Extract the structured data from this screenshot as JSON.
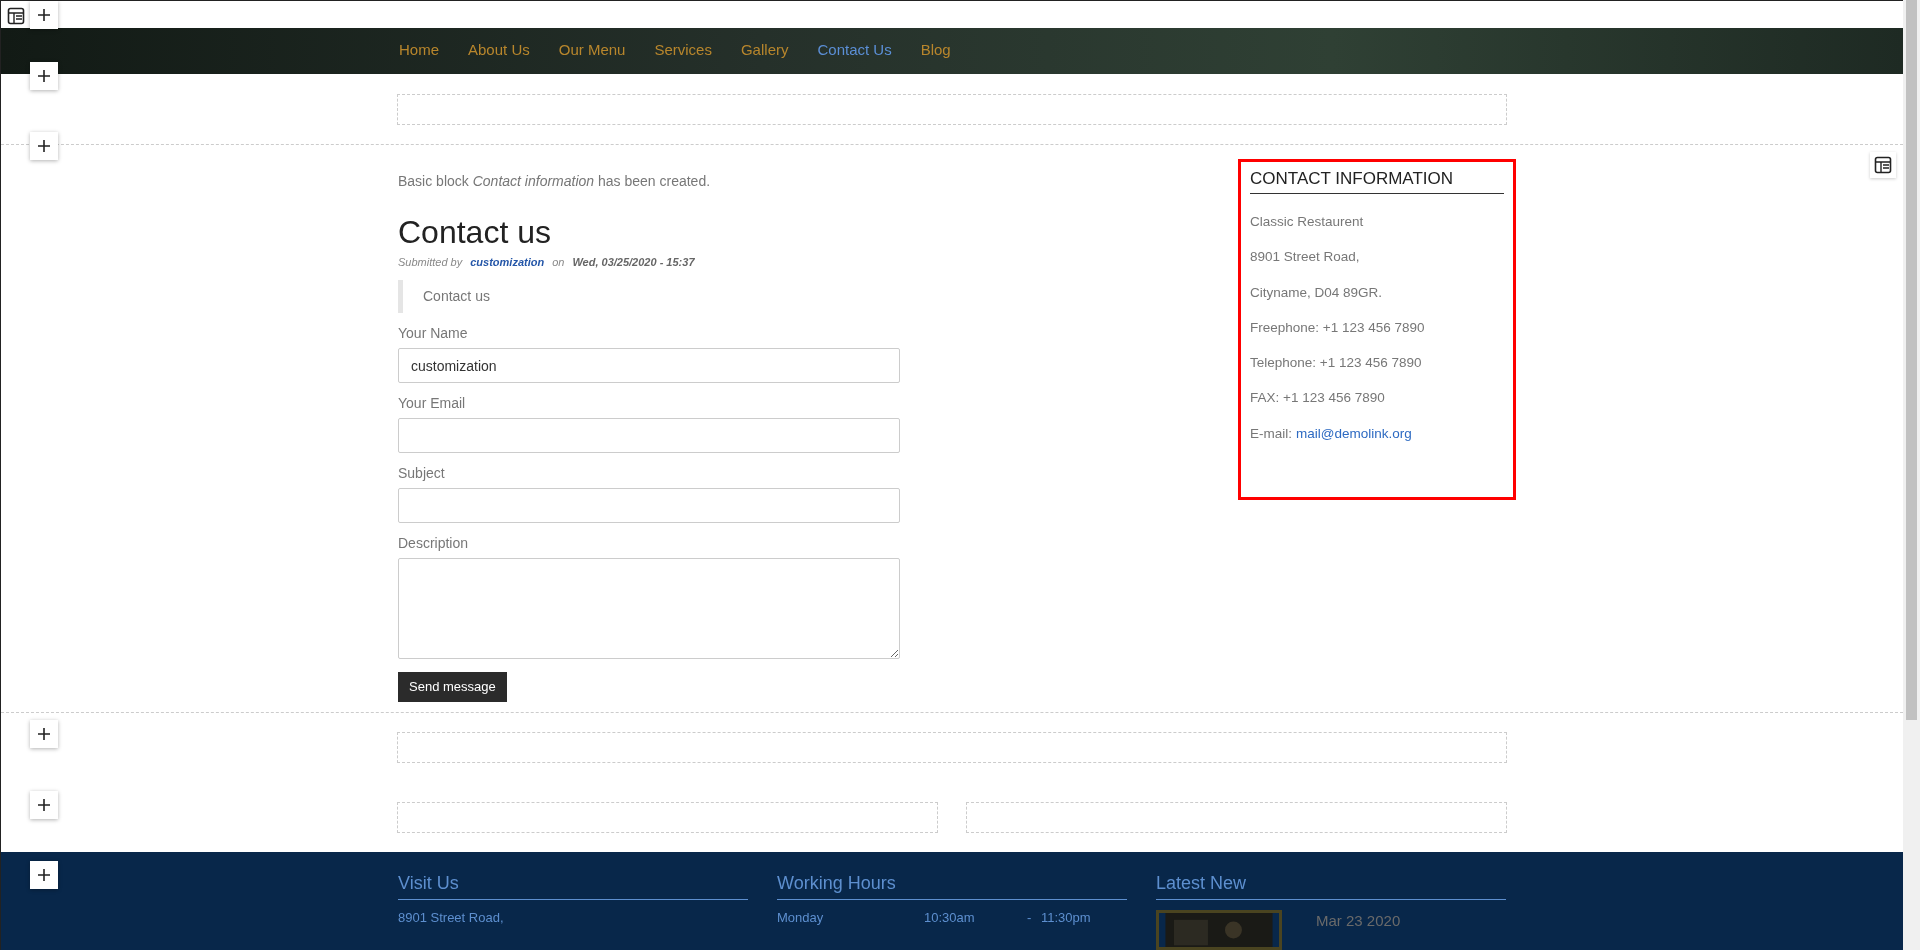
{
  "nav": {
    "items": [
      {
        "label": "Home",
        "selected": false
      },
      {
        "label": "About Us",
        "selected": false
      },
      {
        "label": "Our Menu",
        "selected": false
      },
      {
        "label": "Services",
        "selected": false
      },
      {
        "label": "Gallery",
        "selected": false
      },
      {
        "label": "Contact Us",
        "selected": true
      },
      {
        "label": "Blog",
        "selected": false
      }
    ]
  },
  "notice": "Basic block *Contact information* has been created.",
  "article": {
    "title": "Contact us",
    "submitted_prefix": "Submitted by",
    "author": "customization",
    "on": "on",
    "date": "Wed, 03/25/2020 - 15:37",
    "blockquote": "Contact us",
    "fields": [
      {
        "label": "Your Name",
        "kind": "input",
        "value": "customization"
      },
      {
        "label": "Your Email",
        "kind": "input"
      },
      {
        "label": "Subject",
        "kind": "input"
      },
      {
        "label": "Description",
        "kind": "textarea"
      }
    ],
    "button": "Send message"
  },
  "contact_block": {
    "title": "CONTACT INFORMATION",
    "lines": [
      "Classic Restaurent",
      "8901 Street Road,",
      "Cityname, D04 89GR.",
      "Freephone: +1 123 456 7890",
      "Telephone: +1 123 456 7890",
      "FAX: +1 123 456 7890"
    ],
    "email_label": "E-mail:",
    "email": "mail@demolink.org"
  },
  "footer": {
    "visit": {
      "title": "Visit Us",
      "lines": [
        "8901 Street Road,"
      ]
    },
    "hours": {
      "title": "Working Hours",
      "rows": [
        {
          "day": "Monday",
          "open": "10:30am",
          "dash": "-",
          "close": "11:30pm"
        }
      ]
    },
    "latest": {
      "title": "Latest New",
      "items": [
        {
          "kind": "picture",
          "date": "Mar 23 2020"
        }
      ]
    }
  }
}
